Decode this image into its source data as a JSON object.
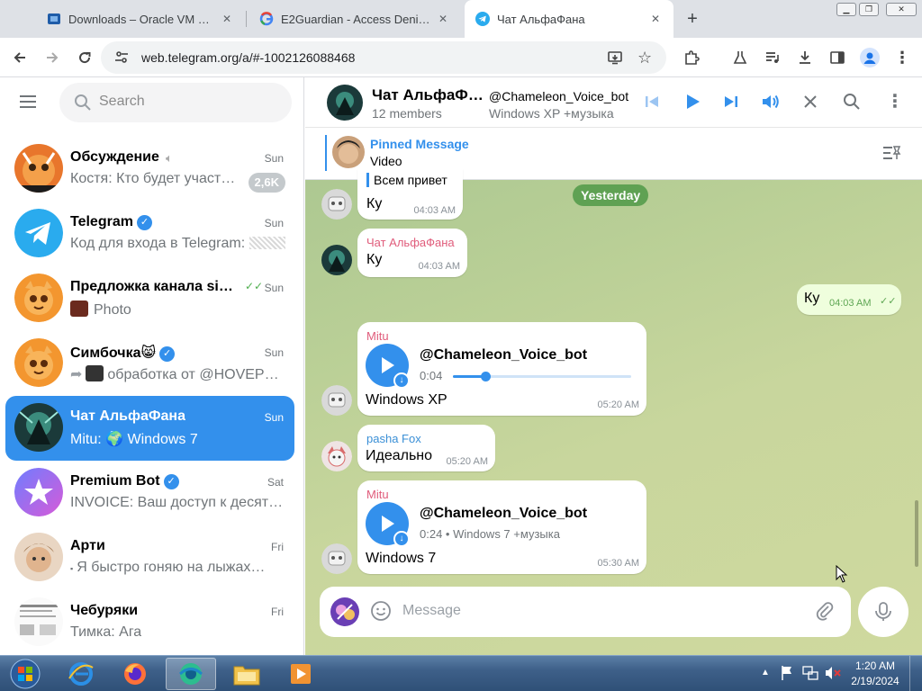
{
  "browser": {
    "tabs": [
      {
        "title": "Downloads – Oracle VM VirtualBox",
        "icon": "virtualbox-icon"
      },
      {
        "title": "E2Guardian - Access Denied",
        "icon": "google-icon"
      },
      {
        "title": "Чат АльфаФана",
        "icon": "telegram-icon"
      }
    ],
    "new_tab": "+",
    "url": "web.telegram.org/a/#-1002126088468"
  },
  "sidebar": {
    "search_placeholder": "Search",
    "chats": [
      {
        "name": "Обсуждение",
        "time": "Sun",
        "preview": "Костя: Кто будет участв…",
        "badge": "2,6K",
        "muted": true
      },
      {
        "name": "Telegram",
        "time": "Sun",
        "preview": "Код для входа в Telegram:",
        "verified": true
      },
      {
        "name": "Предложка канала sim…",
        "time": "Sun",
        "preview": "Photo",
        "read": true
      },
      {
        "name": "Симбочка😸",
        "time": "Sun",
        "preview": "обработка от @HOVEPK…",
        "verified": true
      },
      {
        "name": "Чат АльфаФана",
        "time": "Sun",
        "preview": "Mitu: 🌍 Windows 7",
        "active": true
      },
      {
        "name": "Premium Bot",
        "time": "Sat",
        "preview": "INVOICE: Ваш доступ к десятк…",
        "verified": true
      },
      {
        "name": "Арти",
        "time": "Fri",
        "preview": "Я быстро гоняю на лыжах…"
      },
      {
        "name": "Чебуряки",
        "time": "Fri",
        "preview": "Тимка: Ага"
      }
    ]
  },
  "chat": {
    "title": "Чат АльфаФ…",
    "members": "12 members",
    "player": {
      "title": "@Chameleon_Voice_bot",
      "subtitle": "Windows XP +музыка"
    },
    "pinned": {
      "label": "Pinned Message",
      "text": "Video"
    },
    "date_separator": "Yesterday",
    "messages": [
      {
        "reply": "Всем привет",
        "text": "Ку",
        "time": "04:03 AM"
      },
      {
        "sender": "Чат АльфаФана",
        "text": "Ку",
        "time": "04:03 AM"
      },
      {
        "text": "Ку",
        "time": "04:03 AM",
        "outgoing": true
      },
      {
        "sender": "Mitu",
        "audio_title": "@Chameleon_Voice_bot",
        "audio_meta": "0:04",
        "progress": 0.18,
        "text": "Windows XP",
        "time": "05:20 AM"
      },
      {
        "sender": "pasha Fox",
        "text": "Идеально",
        "time": "05:20 AM"
      },
      {
        "sender": "Mitu",
        "audio_title": "@Chameleon_Voice_bot",
        "audio_meta": "0:24 • Windows 7 +музыка",
        "text": "Windows 7",
        "time": "05:30 AM"
      }
    ],
    "composer_placeholder": "Message"
  },
  "taskbar": {
    "time": "1:20 AM",
    "date": "2/19/2024"
  },
  "colors": {
    "accent": "#3390ec",
    "sender_pink": "#e05c7b",
    "sender_blue": "#3a8fd6",
    "date_pill": "#5fa153"
  }
}
